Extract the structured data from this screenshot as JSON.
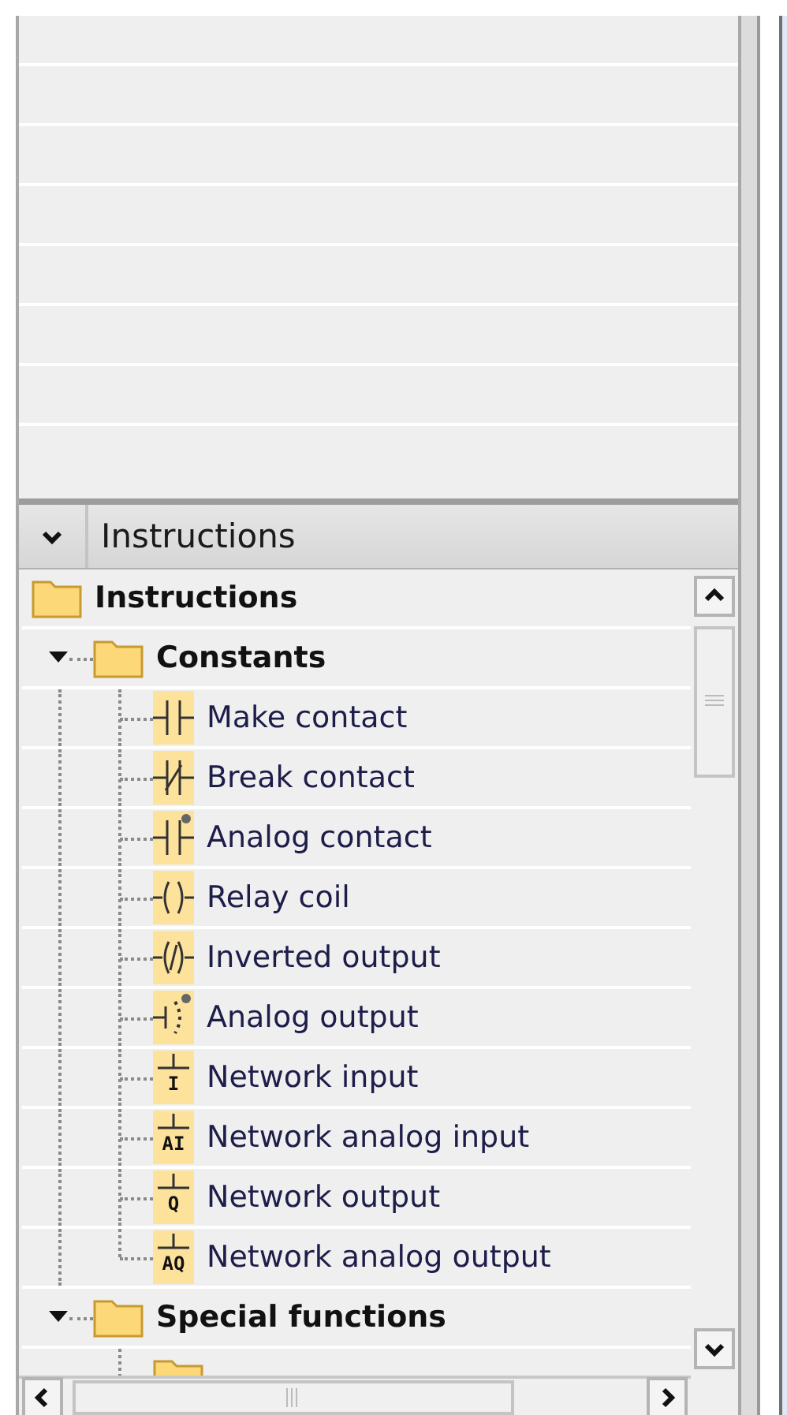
{
  "panel": {
    "title": "Instructions",
    "expanded": true
  },
  "tree": {
    "label": "Instructions",
    "kind": "folder",
    "children": [
      {
        "label": "Constants",
        "kind": "folder",
        "expanded": true,
        "children": [
          {
            "label": "Make contact",
            "kind": "make"
          },
          {
            "label": "Break contact",
            "kind": "break"
          },
          {
            "label": "Analog contact",
            "kind": "analog_contact"
          },
          {
            "label": "Relay coil",
            "kind": "coil"
          },
          {
            "label": "Inverted output",
            "kind": "inverted"
          },
          {
            "label": "Analog output",
            "kind": "analog_output"
          },
          {
            "label": "Network input",
            "kind": "network",
            "symbol": "I"
          },
          {
            "label": "Network analog input",
            "kind": "network",
            "symbol": "AI"
          },
          {
            "label": "Network output",
            "kind": "network",
            "symbol": "Q"
          },
          {
            "label": "Network analog output",
            "kind": "network",
            "symbol": "AQ"
          }
        ]
      },
      {
        "label": "Special functions",
        "kind": "folder",
        "expanded": true,
        "children": [
          {
            "kind": "folder"
          }
        ]
      }
    ]
  }
}
